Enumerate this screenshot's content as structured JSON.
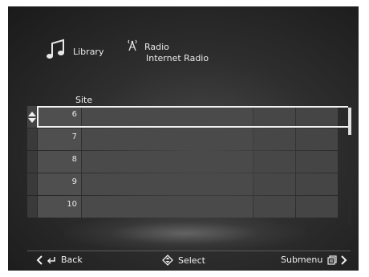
{
  "breadcrumb": {
    "library_label": "Library",
    "radio_label": "Radio",
    "sub_label": "Internet Radio"
  },
  "table": {
    "column_header": "Site",
    "rows": [
      "6",
      "7",
      "8",
      "9",
      "10"
    ],
    "selected_row": "6"
  },
  "footer": {
    "back_label": "Back",
    "select_label": "Select",
    "submenu_label": "Submenu"
  },
  "colors": {
    "background": "#2e2e2e",
    "row": "#4a4a4a",
    "text": "#e8e8e8",
    "selection": "#f2f2f2"
  }
}
